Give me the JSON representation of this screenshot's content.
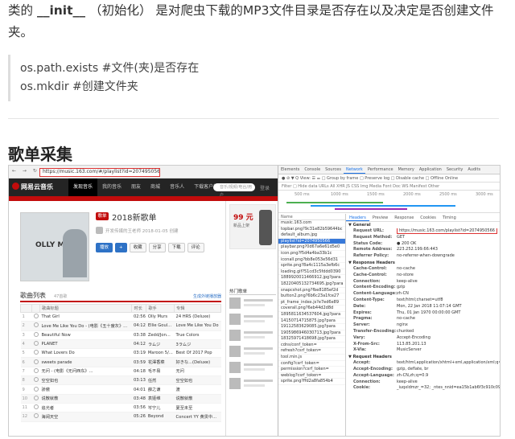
{
  "article": {
    "para_prefix": "类的 ",
    "para_code": "__init__",
    "para_rest": " （初始化） 是对爬虫下载的MP3文件目录是否存在以及决定是否创建文件夹。",
    "code_line_1": "os.path.exists #文件(夹)是否存在",
    "code_line_2": "os.mkdir #创建文件夹",
    "heading": "歌单采集"
  },
  "browser": {
    "nav": "← → ↻",
    "url": "https://music.163.com/#/playlist?id=2074950566"
  },
  "netease": {
    "logo": "网易云音乐",
    "nav": [
      "发现音乐",
      "我的音乐",
      "朋友",
      "商城",
      "音乐人",
      "下载客户端"
    ],
    "search_placeholder": "音乐/视频/电台/用户",
    "login": "登录"
  },
  "playlist": {
    "cover_text": "OLLY MURS",
    "tag": "歌单",
    "title": "2018新歌单",
    "meta": "开发传媒的王老师 2018-01-05 创建",
    "buttons": [
      "播放",
      "+",
      "收藏",
      "分享",
      "下载",
      "评论"
    ],
    "list_title": "歌曲列表",
    "count": "47首歌",
    "outchain": "生成外链播放器",
    "columns": [
      "",
      "",
      "歌曲标题",
      "时长",
      "歌手",
      "专辑"
    ],
    "songs": [
      [
        "1",
        "That Girl",
        "02:56",
        "Olly Murs",
        "24 HRS (Deluxe)"
      ],
      [
        "2",
        "Love Me Like You Do - (电影《五十度灰》...",
        "04:12",
        "Ellie Goul...",
        "Love Me Like You Do"
      ],
      [
        "3",
        "Beautiful Now",
        "03:38",
        "Zedd/Jon...",
        "True Colors"
      ],
      [
        "4",
        "PLANET",
        "04:12",
        "ラムジ",
        "3ラムジ"
      ],
      [
        "5",
        "What Lovers Do",
        "03:19",
        "Maroon 5/...",
        "Best Of 2017 Pop"
      ],
      [
        "6",
        "sweets parade",
        "03:59",
        "花澤香菜",
        "好きな...(Deluxe)"
      ],
      [
        "7",
        "无问 - (电影《无问西东》...",
        "04:18",
        "毛不易",
        "无问"
      ],
      [
        "8",
        "空空如也",
        "03:13",
        "任然",
        "空空如也"
      ],
      [
        "9",
        "骄傲",
        "04:01",
        "薛之谦",
        "渡"
      ],
      [
        "10",
        "说散就散",
        "03:48",
        "袁娅维",
        "说散就散"
      ],
      [
        "11",
        "追光者",
        "03:56",
        "岑宁儿",
        "夏至未至"
      ],
      [
        "12",
        "海阔天空",
        "05:26",
        "Beyond",
        "Concert YY 黄贯中..."
      ]
    ]
  },
  "sidebar": {
    "ad_big": "99 元",
    "ad_small": "新品上架",
    "header": "热门歌单"
  },
  "devtools": {
    "tabs": [
      "Elements",
      "Console",
      "Sources",
      "Network",
      "Performance",
      "Memory",
      "Application",
      "Security",
      "Audits"
    ],
    "toolbar": "● ⊘ ▼ Q  View: ☰ ⚌  □ Group by frame  □ Preserve log  □ Disable cache  □ Offline  Online",
    "filter": "Filter   □ Hide data URLs  All  XHR  JS  CSS  Img  Media  Font  Doc  WS  Manifest  Other",
    "ticks": [
      "500 ms",
      "1000 ms",
      "1500 ms",
      "2000 ms",
      "2500 ms",
      "3000 ms"
    ],
    "list_header": "Name",
    "requests": [
      "music.163.com",
      "topbar.png?9c31e82b59644bc",
      "default_album.jpg",
      "playlist?id=2074950566",
      "playbar.png?0d67a6e61d5e0",
      "icon.png?f5d4a4ba33b1c",
      "iconall.png?bb8e053e56d31",
      "sprite.png?8a4c1115a3efb6c",
      "loading.gif?51cd3c5fddd0390",
      "1889920011466912.jpg?para",
      "18220405132734695.jpg?para",
      "snapcshot.png?fbe8185ef2d",
      "button2.png?6b6c23a1fce27",
      "pt_frame_index.js?e7ed6e89",
      "coverall.png?6eb44d2d8d",
      "1895811634537604.jpg?para",
      "14150714715875.jpg?para",
      "19112583629085.jpg?para",
      "1905986946030713.jpg?para",
      "18325971418698.jpg?para",
      "cdns/conf_token=",
      "refresh?csrf_token=",
      "tool.min.js",
      "config?csrf_token=",
      "permission?csrf_token=",
      "weblog?csrf_token=",
      "sprite.png?ffd2a8fa854b4"
    ],
    "detail_tabs": [
      "Headers",
      "Preview",
      "Response",
      "Cookies",
      "Timing"
    ],
    "general_title": "▼ General",
    "general": [
      [
        "Request URL:",
        "https://music.163.com/playlist?id=2074950566"
      ],
      [
        "Request Method:",
        "GET"
      ],
      [
        "Status Code:",
        "● 200 OK"
      ],
      [
        "Remote Address:",
        "223.252.199.66:443"
      ],
      [
        "Referrer Policy:",
        "no-referrer-when-downgrade"
      ]
    ],
    "response_title": "▼ Response Headers",
    "response": [
      [
        "Cache-Control:",
        "no-cache"
      ],
      [
        "Cache-Control:",
        "no-store"
      ],
      [
        "Connection:",
        "keep-alive"
      ],
      [
        "Content-Encoding:",
        "gzip"
      ],
      [
        "Content-Language:",
        "zh-CN"
      ],
      [
        "Content-Type:",
        "text/html;charset=utf8"
      ],
      [
        "Date:",
        "Mon, 22 Jan 2018 11:07:14 GMT"
      ],
      [
        "Expires:",
        "Thu, 01 Jan 1970 00:00:00 GMT"
      ],
      [
        "Pragma:",
        "no-cache"
      ],
      [
        "Server:",
        "nginx"
      ],
      [
        "Transfer-Encoding:",
        "chunked"
      ],
      [
        "Vary:",
        "Accept-Encoding"
      ],
      [
        "X-From-Src:",
        "113.85.201.13"
      ],
      [
        "X-Via:",
        "MusicServer"
      ]
    ],
    "request_title": "▼ Request Headers",
    "request": [
      [
        "Accept:",
        "text/html,application/xhtml+xml,application/xml;q=0.9,image/webp,*/*"
      ],
      [
        "Accept-Encoding:",
        "gzip, deflate, br"
      ],
      [
        "Accept-Language:",
        "zh-CN,zh;q=0.9"
      ],
      [
        "Connection:",
        "keep-alive"
      ],
      [
        "Cookie:",
        "_iuqxldmzr_=32; _ntes_nnid=ea15b1ab6f3c910c0973392062"
      ]
    ]
  }
}
